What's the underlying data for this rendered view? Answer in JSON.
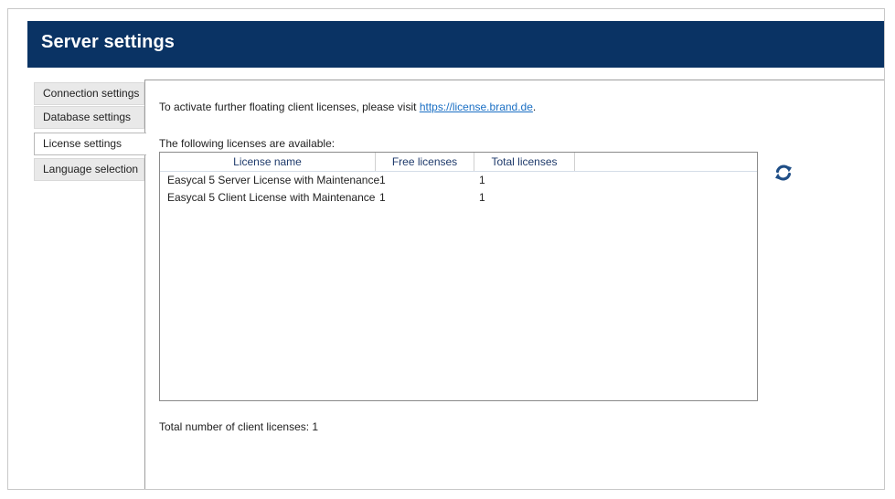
{
  "window": {
    "title": "Server settings"
  },
  "sidebar": {
    "items": [
      {
        "label": "Connection settings"
      },
      {
        "label": "Database settings"
      },
      {
        "label": "License settings"
      },
      {
        "label": "Language selection"
      }
    ],
    "active_index": 2
  },
  "main": {
    "info_text": "To activate further floating client licenses, please visit ",
    "info_link": "https://license.brand.de",
    "info_suffix": ".",
    "available_label": "The following licenses are available:",
    "table": {
      "columns": [
        "License name",
        "Free licenses",
        "Total licenses"
      ],
      "rows": [
        {
          "name": "Easycal 5 Server License with Maintenance",
          "free": "1",
          "total": "1"
        },
        {
          "name": "Easycal 5 Client License with Maintenance",
          "free": "1",
          "total": "1"
        }
      ]
    },
    "refresh_icon": "refresh-icon",
    "total_text": "Total number of client licenses: 1"
  },
  "colors": {
    "header_bg": "#0a3364",
    "link": "#1a6fc4",
    "refresh_icon": "#1f4e86"
  }
}
